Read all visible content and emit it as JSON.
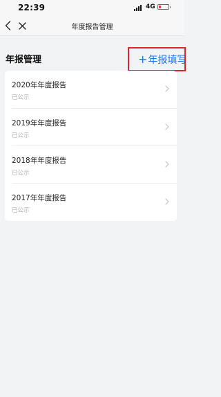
{
  "status_bar": {
    "time": "22:39",
    "network": "4G"
  },
  "nav": {
    "title": "年度报告管理"
  },
  "section": {
    "title": "年报管理",
    "fill_button": {
      "plus": "+",
      "label": "年报填写"
    }
  },
  "reports": [
    {
      "name": "2020年年度报告",
      "status": "已公示"
    },
    {
      "name": "2019年年度报告",
      "status": "已公示"
    },
    {
      "name": "2018年年度报告",
      "status": "已公示"
    },
    {
      "name": "2017年年度报告",
      "status": "已公示"
    }
  ],
  "icons": {
    "back": "chevron-left-icon",
    "close": "close-icon",
    "row_arrow": "chevron-right-icon",
    "signal": "signal-icon",
    "battery": "battery-icon"
  },
  "colors": {
    "accent": "#1a73e8",
    "highlight_border": "#e02424",
    "battery_low": "#e53935",
    "page_bg": "#f2f3f5"
  }
}
